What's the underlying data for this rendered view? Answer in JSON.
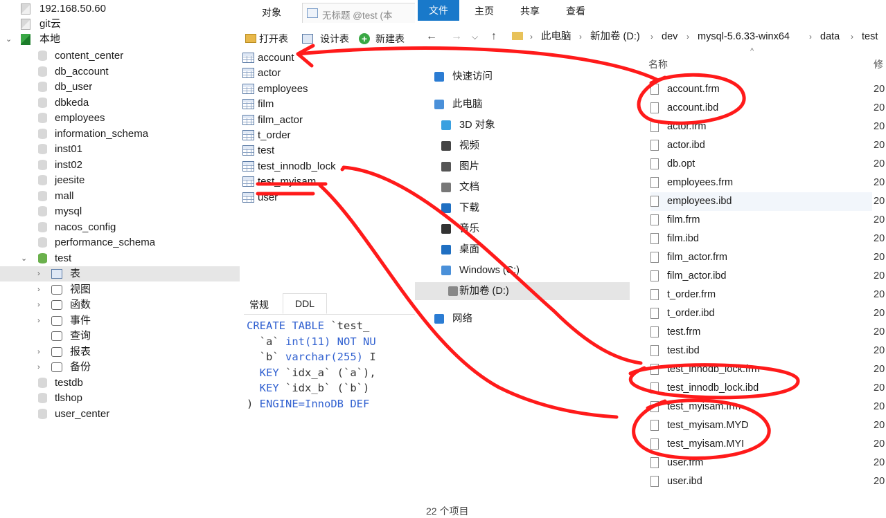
{
  "navicat": {
    "connections": [
      "192.168.50.60",
      "git云",
      "本地"
    ],
    "databases": [
      "content_center",
      "db_account",
      "db_user",
      "dbkeda",
      "employees",
      "information_schema",
      "inst01",
      "inst02",
      "jeesite",
      "mall",
      "mysql",
      "nacos_config",
      "performance_schema",
      "test"
    ],
    "test_children": [
      "表",
      "视图",
      "函数",
      "事件",
      "查询",
      "报表",
      "备份"
    ],
    "databases_after": [
      "testdb",
      "tlshop",
      "user_center"
    ],
    "object_tab": "对象",
    "query_tab": "无标题 @test (本",
    "toolbar": {
      "open": "打开表",
      "design": "设计表",
      "new": "新建表"
    },
    "tables": [
      "account",
      "actor",
      "employees",
      "film",
      "film_actor",
      "t_order",
      "test",
      "test_innodb_lock",
      "test_myisam",
      "user"
    ],
    "detail_tabs": [
      "常规",
      "DDL"
    ],
    "ddl": {
      "line1_kw1": "CREATE",
      "line1_kw2": "TABLE",
      "line1_rest": " `test_",
      "line2_a": "  `a` ",
      "line2_type": "int(11)",
      "line2_rest": " NOT NU",
      "line3_a": "  `b` ",
      "line3_type": "varchar(255)",
      "line3_rest": " I",
      "line4_kw": "  KEY",
      "line4_rest": " `idx_a` (`a`),",
      "line5_kw": "  KEY",
      "line5_rest": " `idx_b` (`b`)",
      "line6_a": ") ",
      "line6_kw": "ENGINE=InnoDB DEF"
    }
  },
  "explorer": {
    "ribbon_tabs": [
      "文件",
      "主页",
      "共享",
      "查看"
    ],
    "path": [
      "此电脑",
      "新加卷 (D:)",
      "dev",
      "mysql-5.6.33-winx64",
      "data",
      "test"
    ],
    "column_name": "名称",
    "column_modified": "修",
    "sidebar": [
      "快速访问",
      "此电脑",
      "3D 对象",
      "视频",
      "图片",
      "文档",
      "下载",
      "音乐",
      "桌面",
      "Windows (C:)",
      "新加卷 (D:)",
      "网络"
    ],
    "files": [
      "account.frm",
      "account.ibd",
      "actor.frm",
      "actor.ibd",
      "db.opt",
      "employees.frm",
      "employees.ibd",
      "film.frm",
      "film.ibd",
      "film_actor.frm",
      "film_actor.ibd",
      "t_order.frm",
      "t_order.ibd",
      "test.frm",
      "test.ibd",
      "test_innodb_lock.frm",
      "test_innodb_lock.ibd",
      "test_myisam.frm",
      "test_myisam.MYD",
      "test_myisam.MYI",
      "user.frm",
      "user.ibd"
    ],
    "date_prefix": "20",
    "status": "22 个项目"
  },
  "colors": {
    "accent": "#1979ca",
    "annotation": "#ff1a1a",
    "db_icon": "#6ab04c",
    "selection": "#e6e6e6"
  }
}
